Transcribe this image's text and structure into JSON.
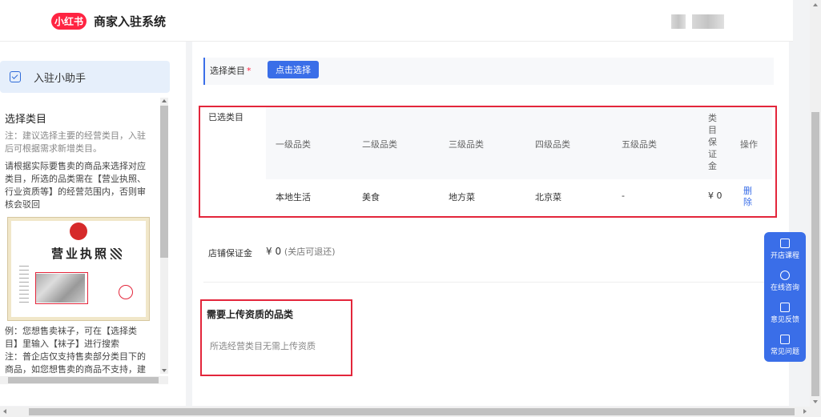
{
  "header": {
    "logo_text": "小红书",
    "title": "商家入驻系统"
  },
  "helper": {
    "label": "入驻小助手",
    "section_title": "选择类目",
    "note": "注：建议选择主要的经营类目，入驻后可根据需求新增类目。",
    "description": "请根据实际要售卖的商品来选择对应类目，所选的品类需在【营业执照、行业资质等】的经营范围内，否则审核会驳回",
    "license_title": "营业执照",
    "example_1": "例：您想售卖袜子，可在【选择类目】里输入【袜子】进行搜索",
    "example_2": "注：普企店仅支持售卖部分类目下的商品，如您想售卖的商品不支持，建议您"
  },
  "category": {
    "label": "选择类目",
    "required_mark": "*",
    "button_label": "点击选择"
  },
  "selected": {
    "label": "已选类目",
    "columns": [
      "一级品类",
      "二级品类",
      "三级品类",
      "四级品类",
      "五级品类",
      "类目保证金",
      "操作"
    ],
    "row": {
      "level1": "本地生活",
      "level2": "美食",
      "level3": "地方菜",
      "level4": "北京菜",
      "level5": "-",
      "deposit": "¥ 0",
      "action": "删除"
    }
  },
  "store_deposit": {
    "label": "店铺保证金",
    "value": "¥ 0",
    "note": "(关店可退还)"
  },
  "qualification": {
    "title": "需要上传资质的品类",
    "text": "所选经营类目无需上传资质"
  },
  "float_bar": {
    "items": [
      "开店课程",
      "在线咨询",
      "意见反馈",
      "常见问题"
    ]
  },
  "colors": {
    "brand_red": "#ff2442",
    "primary_blue": "#3a6ee8",
    "highlight_red": "#e3263b"
  }
}
